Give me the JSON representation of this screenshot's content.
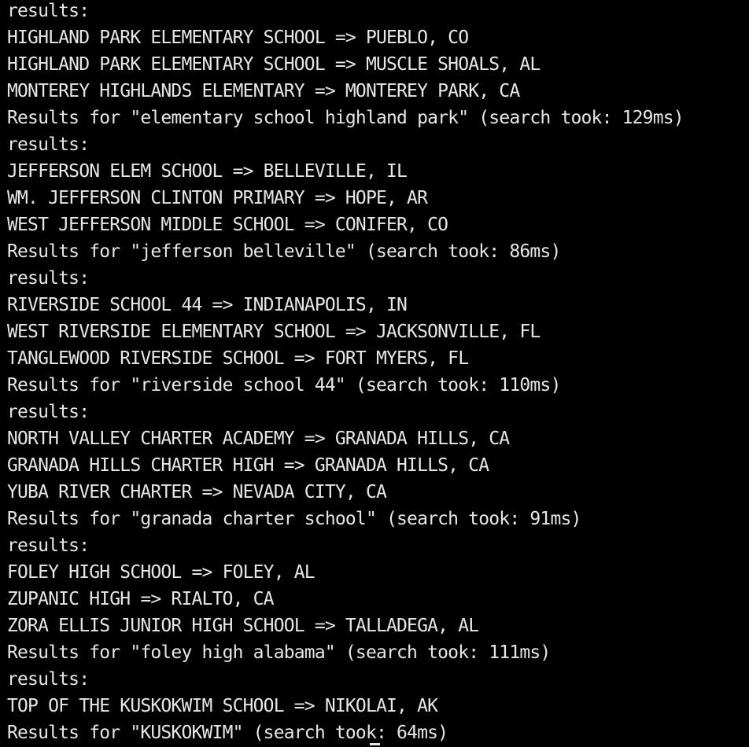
{
  "terminal": {
    "lines": [
      "results:",
      "HIGHLAND PARK ELEMENTARY SCHOOL => PUEBLO, CO",
      "HIGHLAND PARK ELEMENTARY SCHOOL => MUSCLE SHOALS, AL",
      "MONTEREY HIGHLANDS ELEMENTARY => MONTEREY PARK, CA",
      "Results for \"elementary school highland park\" (search took: 129ms)",
      "results:",
      "JEFFERSON ELEM SCHOOL => BELLEVILLE, IL",
      "WM. JEFFERSON CLINTON PRIMARY => HOPE, AR",
      "WEST JEFFERSON MIDDLE SCHOOL => CONIFER, CO",
      "Results for \"jefferson belleville\" (search took: 86ms)",
      "results:",
      "RIVERSIDE SCHOOL 44 => INDIANAPOLIS, IN",
      "WEST RIVERSIDE ELEMENTARY SCHOOL => JACKSONVILLE, FL",
      "TANGLEWOOD RIVERSIDE SCHOOL => FORT MYERS, FL",
      "Results for \"riverside school 44\" (search took: 110ms)",
      "results:",
      "NORTH VALLEY CHARTER ACADEMY => GRANADA HILLS, CA",
      "GRANADA HILLS CHARTER HIGH => GRANADA HILLS, CA",
      "YUBA RIVER CHARTER => NEVADA CITY, CA",
      "Results for \"granada charter school\" (search took: 91ms)",
      "results:",
      "FOLEY HIGH SCHOOL => FOLEY, AL",
      "ZUPANIC HIGH => RIALTO, CA",
      "ZORA ELLIS JUNIOR HIGH SCHOOL => TALLADEGA, AL",
      "Results for \"foley high alabama\" (search took: 111ms)",
      "results:",
      "TOP OF THE KUSKOKWIM SCHOOL => NIKOLAI, AK",
      "Results for \"KUSKOKWIM\" (search took: 64ms)"
    ],
    "background_color": "#000000",
    "text_color": "#e6e6e6"
  }
}
